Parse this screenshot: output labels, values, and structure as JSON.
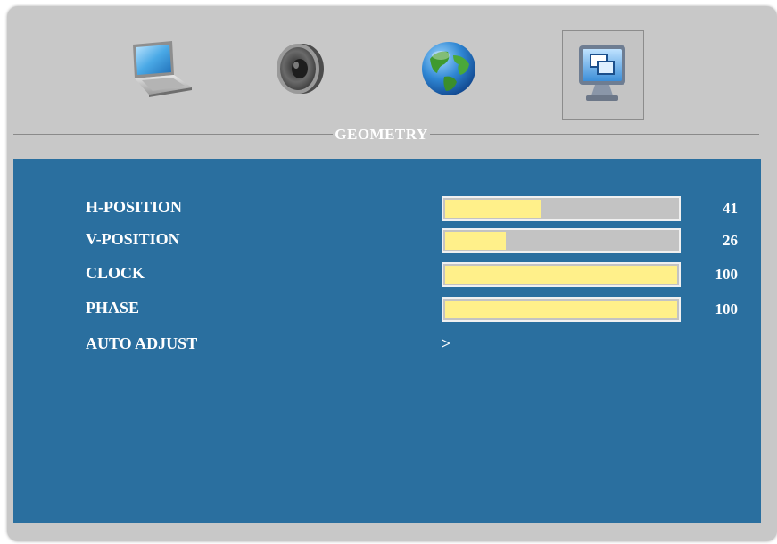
{
  "tabs": [
    {
      "icon": "laptop-icon",
      "active": false
    },
    {
      "icon": "speaker-icon",
      "active": false
    },
    {
      "icon": "globe-icon",
      "active": false
    },
    {
      "icon": "monitor-geometry-icon",
      "active": true
    }
  ],
  "section": {
    "title": "GEOMETRY"
  },
  "items": [
    {
      "label": "H-POSITION",
      "value": "41",
      "level": 0.41
    },
    {
      "label": "V-POSITION",
      "value": "26",
      "level": 0.26
    },
    {
      "label": "CLOCK",
      "value": "100",
      "level": 1.0
    },
    {
      "label": "PHASE",
      "value": "100",
      "level": 1.0
    },
    {
      "label": "AUTO ADJUST",
      "arrow": ">"
    }
  ],
  "colors": {
    "frame": "#c8c8c8",
    "panel": "#2a6f9f",
    "bar_track": "#c3c3c3",
    "bar_fill": "#fff08a",
    "text": "#ffffff"
  }
}
